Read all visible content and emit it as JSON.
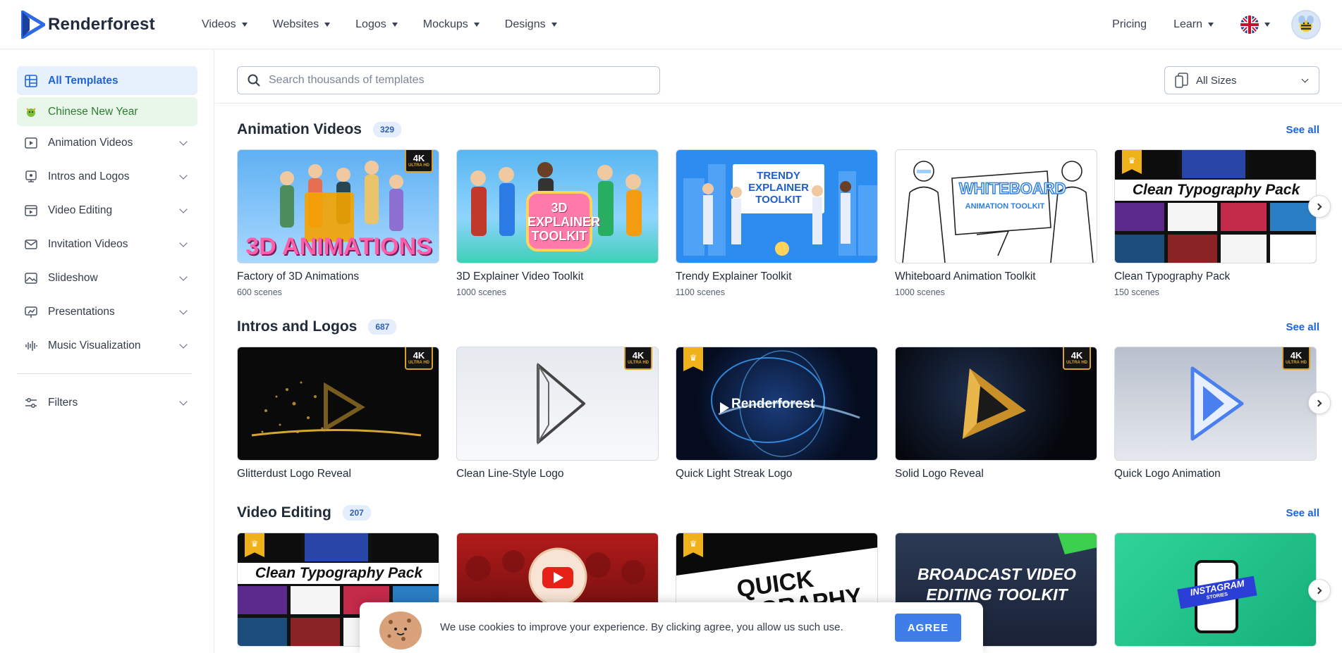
{
  "header": {
    "brand": "Renderforest",
    "nav": [
      {
        "label": "Videos"
      },
      {
        "label": "Websites"
      },
      {
        "label": "Logos"
      },
      {
        "label": "Mockups"
      },
      {
        "label": "Designs"
      }
    ],
    "pricing": "Pricing",
    "learn": "Learn"
  },
  "sidebar": {
    "items": [
      {
        "label": "All Templates"
      },
      {
        "label": "Chinese New Year"
      },
      {
        "label": "Animation Videos"
      },
      {
        "label": "Intros and Logos"
      },
      {
        "label": "Video Editing"
      },
      {
        "label": "Invitation Videos"
      },
      {
        "label": "Slideshow"
      },
      {
        "label": "Presentations"
      },
      {
        "label": "Music Visualization"
      }
    ],
    "filters": "Filters"
  },
  "search": {
    "placeholder": "Search thousands of templates"
  },
  "size_filter": {
    "value": "All Sizes"
  },
  "sections": [
    {
      "title": "Animation Videos",
      "count": "329",
      "see_all": "See all",
      "cards": [
        {
          "title": "Factory of 3D Animations",
          "sub": "600 scenes",
          "art": "3D ANIMATIONS"
        },
        {
          "title": "3D Explainer Video Toolkit",
          "sub": "1000 scenes",
          "art": "3D EXPLAINER TOOLKIT"
        },
        {
          "title": "Trendy Explainer Toolkit",
          "sub": "1100 scenes",
          "art": "TRENDY EXPLAINER TOOLKIT"
        },
        {
          "title": "Whiteboard Animation Toolkit",
          "sub": "1000 scenes",
          "art": "WHITEBOARD",
          "art2": "ANIMATION TOOLKIT"
        },
        {
          "title": "Clean Typography Pack",
          "sub": "150 scenes",
          "art": "Clean Typography Pack"
        }
      ]
    },
    {
      "title": "Intros and Logos",
      "count": "687",
      "see_all": "See all",
      "cards": [
        {
          "title": "Glitterdust Logo Reveal"
        },
        {
          "title": "Clean Line-Style Logo"
        },
        {
          "title": "Quick Light Streak Logo",
          "art": "Renderforest"
        },
        {
          "title": "Solid Logo Reveal"
        },
        {
          "title": "Quick Logo Animation"
        }
      ]
    },
    {
      "title": "Video Editing",
      "count": "207",
      "see_all": "See all",
      "cards": [
        {
          "art": "Clean Typography Pack"
        },
        {},
        {
          "art": "QUICK TYPOGRAPHY PACK"
        },
        {
          "art": "BROADCAST VIDEO EDITING TOOLKIT"
        },
        {
          "art": "INSTAGRAM",
          "art2": "STORIES"
        }
      ]
    }
  ],
  "badges": {
    "k4": "4K",
    "uhd": "ULTRA HD"
  },
  "cookie": {
    "text": "We use cookies to improve your experience. By clicking agree, you allow us such use.",
    "button": "AGREE"
  },
  "colors": {
    "accent": "#1d63d9",
    "agree": "#3f7ee8",
    "active_bg": "#e7f0fd",
    "cny_bg": "#e9f7ea"
  }
}
